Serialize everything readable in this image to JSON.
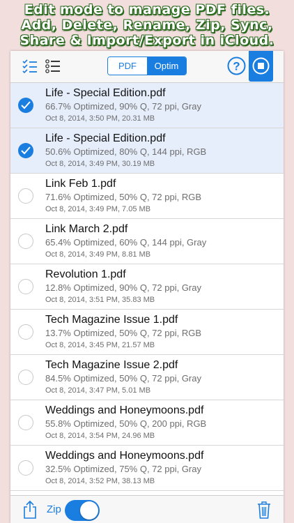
{
  "banner": {
    "line1": "Edit mode to manage PDF files.",
    "line2": "Add, Delete, Rename, Zip, Sync,",
    "line3": "Share & Import/Export in iCloud."
  },
  "toolbar": {
    "select_all_icon": "checklist-icon",
    "sort_icon": "numbered-list-icon",
    "segments": [
      {
        "label": "PDF",
        "selected": false
      },
      {
        "label": "Optim",
        "selected": true
      }
    ],
    "help_icon": "help-icon",
    "stop_icon": "stop-icon"
  },
  "files": [
    {
      "name": "Life - Special Edition.pdf",
      "info": "66.7% Optimized, 90% Q, 72 ppi, Gray",
      "date": "Oct 8, 2014, 3:50 PM, 20.31 MB",
      "selected": true
    },
    {
      "name": "Life - Special Edition.pdf",
      "info": "50.6% Optimized, 80% Q, 144 ppi, RGB",
      "date": "Oct 8, 2014, 3:49 PM, 30.19 MB",
      "selected": true
    },
    {
      "name": "Link Feb 1.pdf",
      "info": "71.6% Optimized, 50% Q, 72 ppi, RGB",
      "date": "Oct 8, 2014, 3:49 PM, 7.05 MB",
      "selected": false
    },
    {
      "name": "Link March 2.pdf",
      "info": "65.4% Optimized, 60% Q, 144 ppi, Gray",
      "date": "Oct 8, 2014, 3:49 PM, 8.81 MB",
      "selected": false
    },
    {
      "name": "Revolution 1.pdf",
      "info": "12.8% Optimized, 90% Q, 72 ppi, Gray",
      "date": "Oct 8, 2014, 3:51 PM, 35.83 MB",
      "selected": false
    },
    {
      "name": "Tech Magazine Issue 1.pdf",
      "info": "13.7% Optimized, 50% Q, 72 ppi, RGB",
      "date": "Oct 8, 2014, 3:45 PM, 21.57 MB",
      "selected": false
    },
    {
      "name": "Tech Magazine Issue 2.pdf",
      "info": "84.5% Optimized, 50% Q, 72 ppi, Gray",
      "date": "Oct 8, 2014, 3:47 PM, 5.01 MB",
      "selected": false
    },
    {
      "name": "Weddings and Honeymoons.pdf",
      "info": "55.8% Optimized, 50% Q, 200 ppi, RGB",
      "date": "Oct 8, 2014, 3:54 PM, 24.96 MB",
      "selected": false
    },
    {
      "name": "Weddings and Honeymoons.pdf",
      "info": "32.5% Optimized, 75% Q, 72 ppi, Gray",
      "date": "Oct 8, 2014, 3:52 PM, 38.13 MB",
      "selected": false
    }
  ],
  "bottombar": {
    "share_icon": "share-icon",
    "zip_label": "Zip",
    "zip_on": true,
    "trash_icon": "trash-icon"
  },
  "colors": {
    "accent": "#1a7de0",
    "selected_row": "#e6eefb",
    "banner_text": "#ffffff",
    "banner_outline": "#2a6b1e",
    "background": "#f3dede"
  }
}
